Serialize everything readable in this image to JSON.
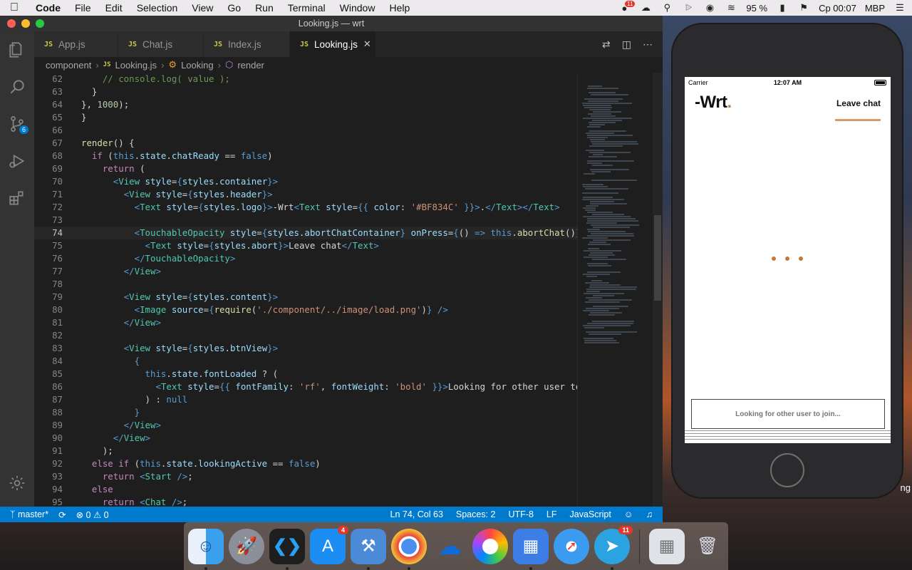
{
  "menubar": {
    "app": "Code",
    "items": [
      "File",
      "Edit",
      "Selection",
      "View",
      "Go",
      "Run",
      "Terminal",
      "Window",
      "Help"
    ],
    "notif_badge": "11",
    "battery": "95 %",
    "clock": "Ср 00:07",
    "host": "MBP"
  },
  "window": {
    "title": "Looking.js — wrt"
  },
  "activity": {
    "scm_badge": "6"
  },
  "tabs": [
    {
      "label": "App.js"
    },
    {
      "label": "Chat.js"
    },
    {
      "label": "Index.js"
    },
    {
      "label": "Looking.js"
    }
  ],
  "breadcrumb": {
    "folder": "component",
    "file": "Looking.js",
    "class": "Looking",
    "method": "render"
  },
  "code": {
    "lines": [
      {
        "n": "62"
      },
      {
        "n": "63"
      },
      {
        "n": "64"
      },
      {
        "n": "65"
      },
      {
        "n": "66"
      },
      {
        "n": "67"
      },
      {
        "n": "68"
      },
      {
        "n": "69"
      },
      {
        "n": "70"
      },
      {
        "n": "71"
      },
      {
        "n": "72"
      },
      {
        "n": "73"
      },
      {
        "n": "74"
      },
      {
        "n": "75"
      },
      {
        "n": "76"
      },
      {
        "n": "77"
      },
      {
        "n": "78"
      },
      {
        "n": "79"
      },
      {
        "n": "80"
      },
      {
        "n": "81"
      },
      {
        "n": "82"
      },
      {
        "n": "83"
      },
      {
        "n": "84"
      },
      {
        "n": "85"
      },
      {
        "n": "86"
      },
      {
        "n": "87"
      },
      {
        "n": "88"
      },
      {
        "n": "89"
      },
      {
        "n": "90"
      },
      {
        "n": "91"
      },
      {
        "n": "92"
      },
      {
        "n": "93"
      },
      {
        "n": "94"
      },
      {
        "n": "95"
      }
    ]
  },
  "statusbar": {
    "branch": "master*",
    "errors": "0",
    "warnings": "0",
    "position": "Ln 74, Col 63",
    "spaces": "Spaces: 2",
    "encoding": "UTF-8",
    "eol": "LF",
    "language": "JavaScript"
  },
  "phone": {
    "carrier": "Carrier",
    "time": "12:07 AM",
    "logo": "-Wrt",
    "logo_dot": ".",
    "leave": "Leave chat",
    "looking": "Looking for other user to join...",
    "accent": "#BF834C"
  },
  "dock": {
    "appstore_badge": "4",
    "telegram_badge": "11"
  },
  "sim_cut_text": "ng"
}
